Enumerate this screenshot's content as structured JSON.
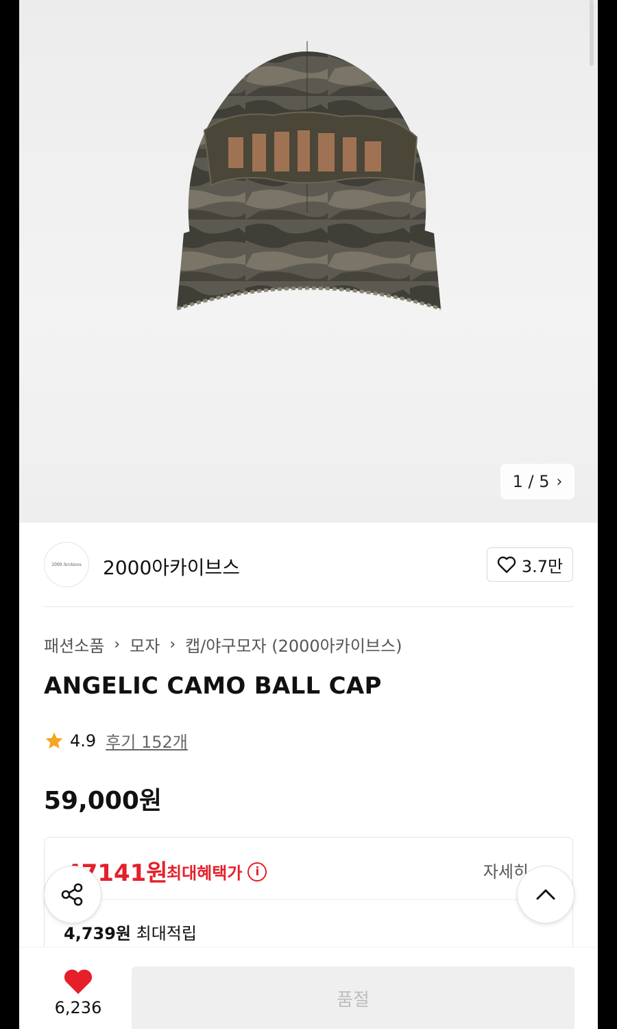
{
  "hero": {
    "pager_current": "1",
    "pager_total": "5",
    "pager_text": "1 / 5"
  },
  "shop": {
    "name": "2000아카이브스",
    "logo_text": "2000 Archives",
    "like_count": "3.7만"
  },
  "breadcrumb": [
    "패션소품",
    "모자",
    "캡/야구모자 (2000아카이브스)"
  ],
  "product": {
    "title": "ANGELIC CAMO BALL CAP",
    "rating": "4.9",
    "reviews": "후기 152개",
    "price": "59,000원"
  },
  "benefit": {
    "max_price": "47141원",
    "max_label": "최대혜택가",
    "detail_link": "자세히",
    "points_amount": "4,739원",
    "points_label": "최대적립"
  },
  "bottom": {
    "wish_count": "6,236",
    "buy_label": "품절"
  },
  "colors": {
    "accent_red": "#e5202a",
    "star": "#f5a623"
  }
}
